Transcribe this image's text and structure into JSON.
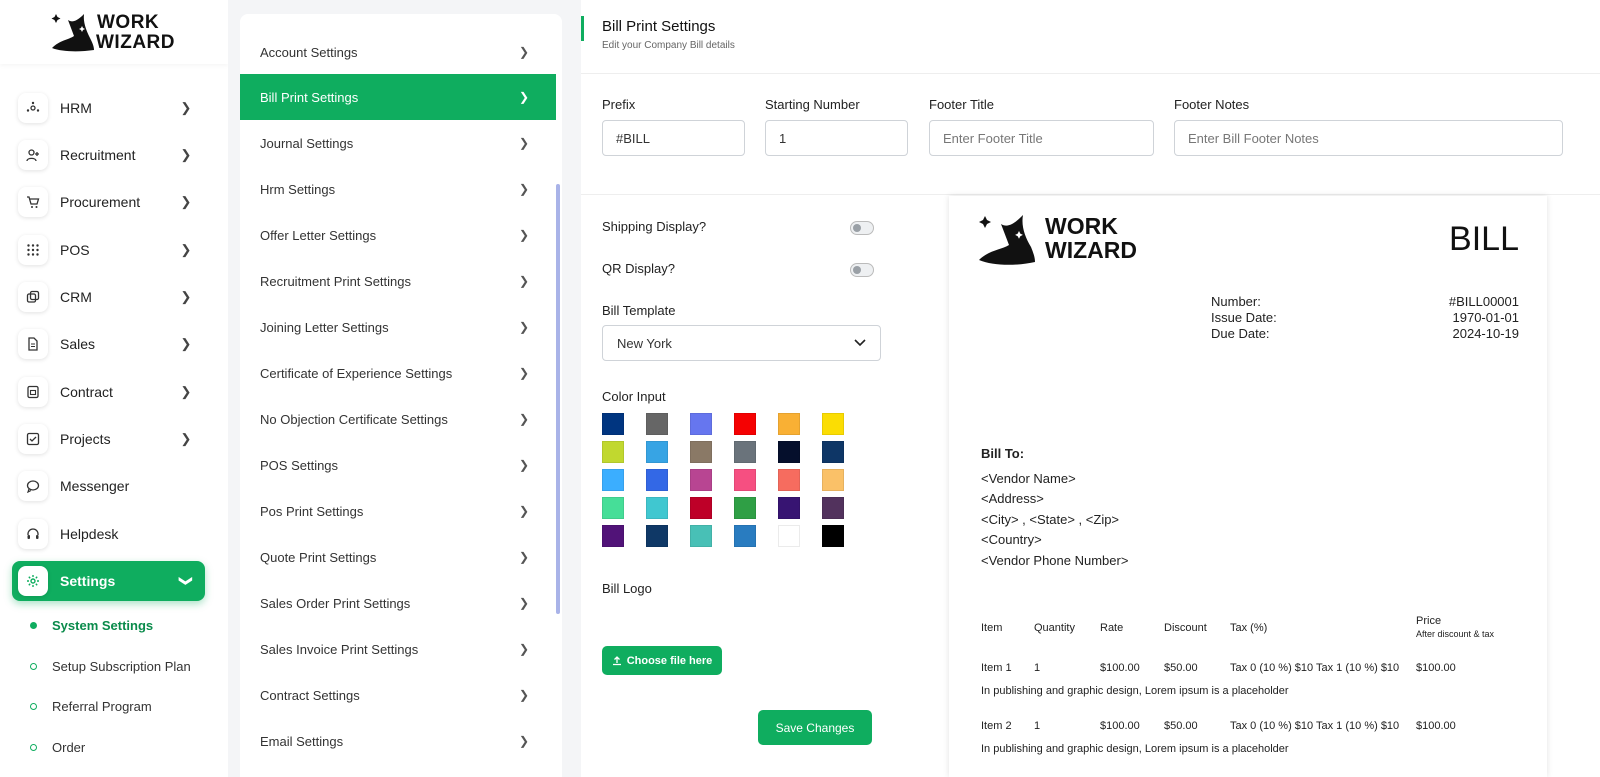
{
  "brand": {
    "line1": "WORK",
    "line2": "WIZARD"
  },
  "sidebar": {
    "items": [
      {
        "label": "HRM",
        "icon": "hrm-icon"
      },
      {
        "label": "Recruitment",
        "icon": "user-plus-icon"
      },
      {
        "label": "Procurement",
        "icon": "cart-icon"
      },
      {
        "label": "POS",
        "icon": "grid-icon"
      },
      {
        "label": "CRM",
        "icon": "crm-icon"
      },
      {
        "label": "Sales",
        "icon": "document-icon"
      },
      {
        "label": "Contract",
        "icon": "contract-icon"
      },
      {
        "label": "Projects",
        "icon": "checkbox-icon"
      },
      {
        "label": "Messenger",
        "icon": "chat-icon"
      },
      {
        "label": "Helpdesk",
        "icon": "headset-icon"
      },
      {
        "label": "Settings",
        "icon": "gear-icon"
      }
    ],
    "sub_items": [
      {
        "label": "System Settings"
      },
      {
        "label": "Setup Subscription Plan"
      },
      {
        "label": "Referral Program"
      },
      {
        "label": "Order"
      }
    ]
  },
  "settings_menu": [
    "Account Settings",
    "Bill Print Settings",
    "Journal Settings",
    "Hrm Settings",
    "Offer Letter Settings",
    "Recruitment Print Settings",
    "Joining Letter Settings",
    "Certificate of Experience Settings",
    "No Objection Certificate Settings",
    "POS Settings",
    "Pos Print Settings",
    "Quote Print Settings",
    "Sales Order Print Settings",
    "Sales Invoice Print Settings",
    "Contract Settings",
    "Email Settings"
  ],
  "main": {
    "title": "Bill Print Settings",
    "subtitle": "Edit your Company Bill details",
    "prefix_label": "Prefix",
    "prefix_value": "#BILL",
    "starting_number_label": "Starting Number",
    "starting_number_value": "1",
    "footer_title_label": "Footer Title",
    "footer_title_placeholder": "Enter Footer Title",
    "footer_notes_label": "Footer Notes",
    "footer_notes_placeholder": "Enter Bill Footer Notes",
    "shipping_label": "Shipping Display?",
    "qr_label": "QR Display?",
    "template_label": "Bill Template",
    "template_value": "New York",
    "color_label": "Color Input",
    "colors": [
      "#003580",
      "#666666",
      "#6676ef",
      "#f50102",
      "#f9b034",
      "#fbdd03",
      "#c1d82f",
      "#37a4e4",
      "#8a7966",
      "#6a737b",
      "#050f2c",
      "#0e3666",
      "#3baeff",
      "#3368e6",
      "#b84592",
      "#f64f81",
      "#f66c5f",
      "#fac168",
      "#46de98",
      "#40c7d0",
      "#be0028",
      "#2f9f45",
      "#371472",
      "#52325d",
      "#511378",
      "#0f3866",
      "#48c0b6",
      "#297cc0",
      "#ffffff",
      "#000000"
    ],
    "logo_label": "Bill Logo",
    "choose_file_label": "Choose file here",
    "save_label": "Save Changes"
  },
  "preview": {
    "logo_line1": "WORK",
    "logo_line2": "WIZARD",
    "heading": "BILL",
    "number_label": "Number:",
    "number_value": "#BILL00001",
    "issue_label": "Issue Date:",
    "issue_value": "1970-01-01",
    "due_label": "Due Date:",
    "due_value": "2024-10-19",
    "bill_to": "Bill To:",
    "address_lines": [
      "<Vendor Name>",
      "<Address>",
      "<City> , <State> , <Zip>",
      "<Country>",
      "<Vendor Phone Number>"
    ],
    "columns": {
      "item": "Item",
      "quantity": "Quantity",
      "rate": "Rate",
      "discount": "Discount",
      "tax": "Tax (%)",
      "price": "Price",
      "price_sub": "After discount & tax"
    },
    "rows": [
      {
        "item": "Item 1",
        "qty": "1",
        "rate": "$100.00",
        "discount": "$50.00",
        "tax": "Tax 0 (10 %) $10 Tax 1 (10 %) $10",
        "price": "$100.00",
        "desc": "In publishing and graphic design, Lorem ipsum is a placeholder"
      },
      {
        "item": "Item 2",
        "qty": "1",
        "rate": "$100.00",
        "discount": "$50.00",
        "tax": "Tax 0 (10 %) $10 Tax 1 (10 %) $10",
        "price": "$100.00",
        "desc": "In publishing and graphic design, Lorem ipsum is a placeholder"
      }
    ]
  }
}
